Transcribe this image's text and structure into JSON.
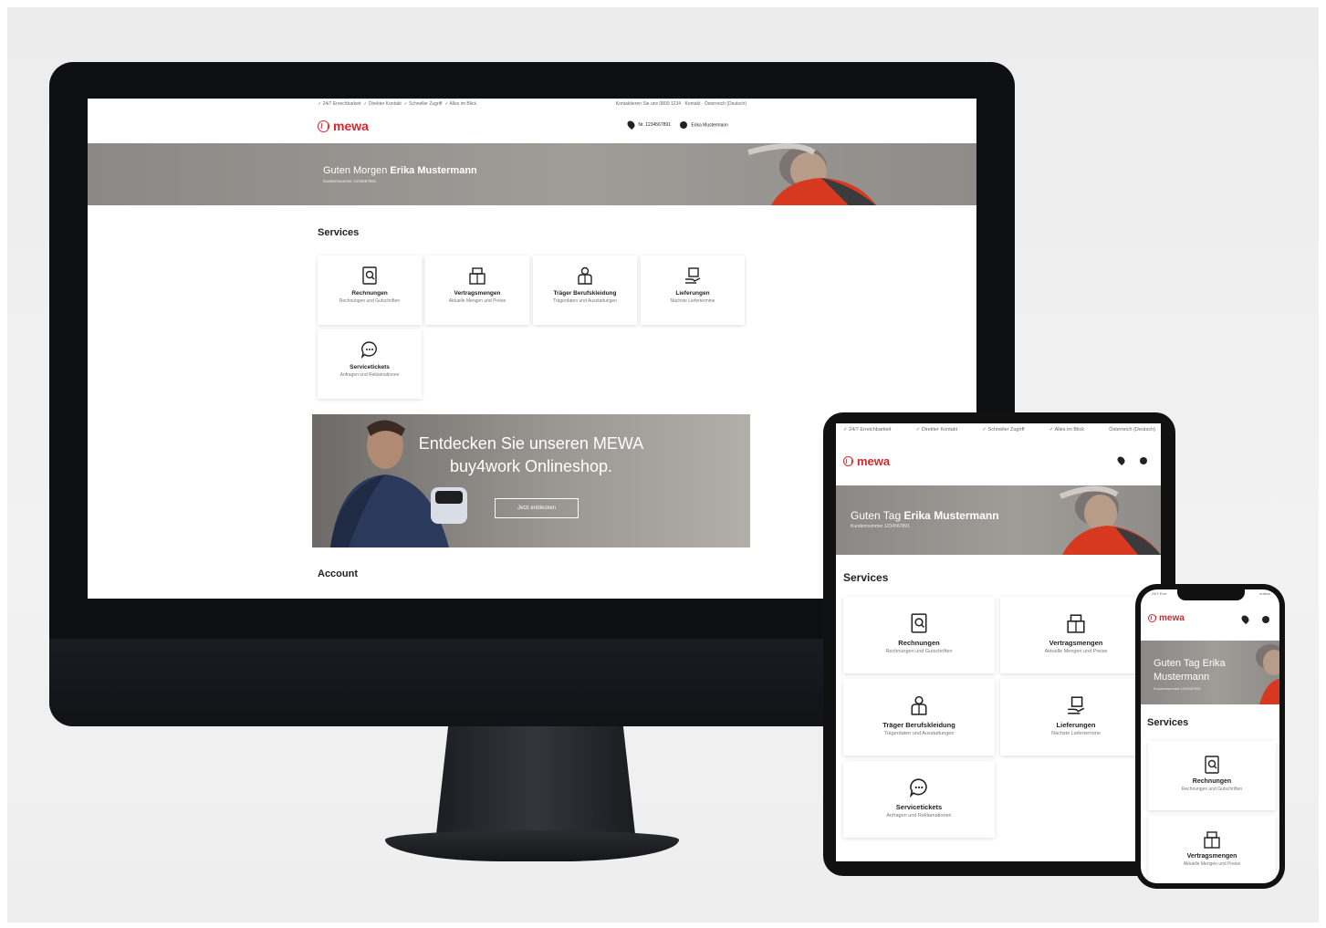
{
  "brand": {
    "name": "mewa",
    "accent": "#d8262c"
  },
  "desktop": {
    "topbar_left": [
      "✓ 24/7 Erreichbarkeit",
      "✓ Direkter Kontakt",
      "✓ Schneller Zugriff",
      "✓ Alles im Blick"
    ],
    "topbar_right": "Kontaktieren Sie uns 0800 1234 · Kontakt · Österreich (Deutsch)",
    "customer_no": "Nr. 1234567891",
    "user_name": "Erika Mustermann",
    "hero_greeting_prefix": "Guten Morgen",
    "hero_greeting_name": "Erika Mustermann",
    "hero_sub": "Kundennummer 1234567891",
    "services_title": "Services",
    "services": [
      {
        "title": "Rechnungen",
        "subtitle": "Rechnungen und Gutschriften",
        "icon": "invoice-search-icon"
      },
      {
        "title": "Vertragsmengen",
        "subtitle": "Aktuelle Mengen und Preise",
        "icon": "boxes-icon"
      },
      {
        "title": "Träger Berufskleidung",
        "subtitle": "Trägerdaten und Ausstattungen",
        "icon": "wearer-icon"
      },
      {
        "title": "Lieferungen",
        "subtitle": "Nächste Liefertermine",
        "icon": "delivery-icon"
      },
      {
        "title": "Servicetickets",
        "subtitle": "Anfragen und Reklamationen",
        "icon": "chat-bubble-icon"
      }
    ],
    "promo_headline": "Entdecken Sie unseren MEWA buy4work Onlineshop.",
    "promo_cta": "Jetzt entdecken",
    "account_title": "Account"
  },
  "tablet": {
    "topbar": [
      "✓ 24/7 Erreichbarkeit",
      "✓ Direkter Kontakt",
      "✓ Schneller Zugriff",
      "✓ Alles im Blick",
      "Österreich (Deutsch)"
    ],
    "hero_greeting_prefix": "Guten Tag",
    "hero_greeting_name": "Erika Mustermann",
    "hero_sub": "Kundennummer 1234567891",
    "services_title": "Services",
    "services": [
      {
        "title": "Rechnungen",
        "subtitle": "Rechnungen und Gutschriften"
      },
      {
        "title": "Vertragsmengen",
        "subtitle": "Aktuelle Mengen und Preise"
      },
      {
        "title": "Träger Berufskleidung",
        "subtitle": "Trägerdaten und Ausstattungen"
      },
      {
        "title": "Lieferungen",
        "subtitle": "Nächste Liefertermine"
      },
      {
        "title": "Servicetickets",
        "subtitle": "Anfragen und Reklamationen"
      }
    ]
  },
  "phone": {
    "topbar_left": "24/7 Erre",
    "topbar_right": "eutsch",
    "hero_greeting": "Guten Tag Erika Mustermann",
    "hero_sub": "Kundennummer 1234567891",
    "services_title": "Services",
    "services": [
      {
        "title": "Rechnungen",
        "subtitle": "Rechnungen und Gutschriften"
      },
      {
        "title": "Vertragsmengen",
        "subtitle": "Aktuelle Mengen und Preise"
      }
    ]
  }
}
